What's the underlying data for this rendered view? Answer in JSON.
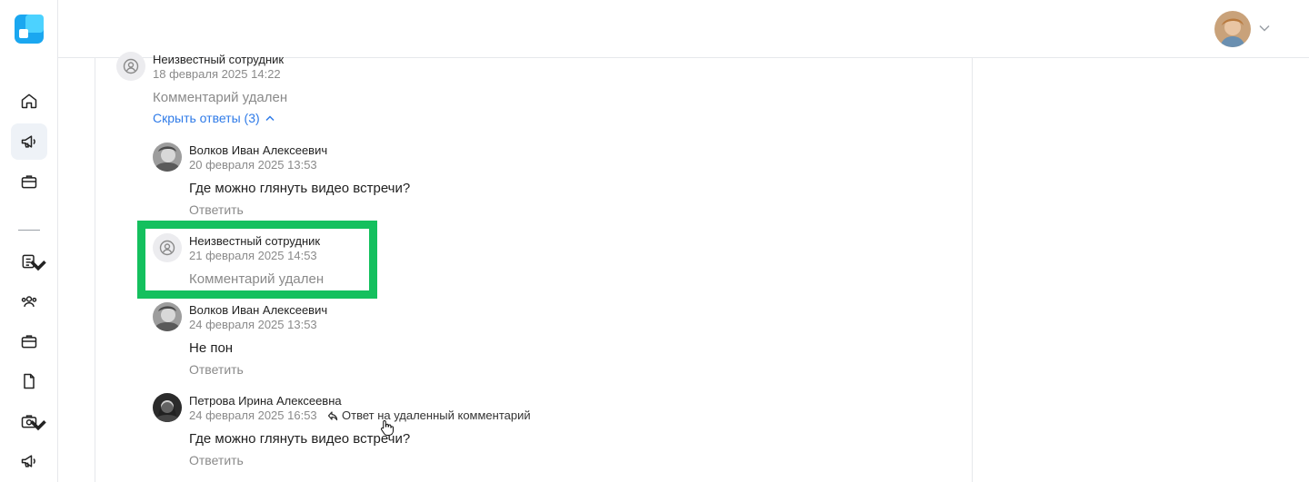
{
  "colors": {
    "accent": "#2f7be8",
    "highlight": "#14c05e",
    "muted": "#8a8a8a"
  },
  "sidebar": {
    "logo": "app-logo",
    "items": [
      {
        "icon": "home-icon"
      },
      {
        "icon": "megaphone-icon",
        "active": true
      },
      {
        "icon": "briefcase-icon"
      },
      {
        "icon": "document-list-icon",
        "dropdown": true
      },
      {
        "icon": "users-icon"
      },
      {
        "icon": "briefcase-icon"
      },
      {
        "icon": "file-icon"
      },
      {
        "icon": "camera-box-icon",
        "dropdown": true
      },
      {
        "icon": "megaphone-icon"
      }
    ]
  },
  "topbar": {
    "avatar": "user-avatar",
    "menu_icon": "chevron-down-icon"
  },
  "comments": {
    "parent": {
      "author": "Неизвестный сотрудник",
      "date": "18 февраля 2025 14:22",
      "text": "Комментарий удален",
      "toggle": "Скрыть ответы (3)"
    },
    "replies": [
      {
        "author": "Волков Иван Алексеевич",
        "date": "20 февраля 2025 13:53",
        "text": "Где можно глянуть видео встречи?",
        "reply": "Ответить"
      },
      {
        "author": "Неизвестный сотрудник",
        "date": "21 февраля 2025 14:53",
        "text": "Комментарий удален"
      },
      {
        "author": "Волков Иван Алексеевич",
        "date": "24 февраля 2025 13:53",
        "text": "Не пон",
        "reply": "Ответить"
      },
      {
        "author": "Петрова Ирина Алексеевна",
        "date": "24 февраля 2025 16:53",
        "reply_to": "Ответ на удаленный комментарий",
        "text": "Где можно глянуть видео встречи?",
        "reply": "Ответить"
      }
    ]
  }
}
